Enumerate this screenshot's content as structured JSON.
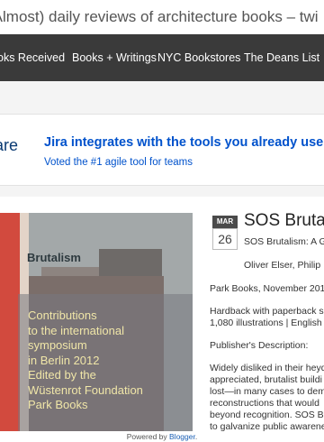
{
  "header": {
    "tagline": "(Almost) daily reviews of architecture books – twi"
  },
  "nav": {
    "items": [
      "oks Received",
      "Books + Writings",
      "NYC Bookstores",
      "The Deans List"
    ]
  },
  "ad": {
    "left_word": "are",
    "headline": "Jira integrates with the tools you already use",
    "subline": "Voted the #1 agile tool for teams"
  },
  "post": {
    "date_month": "MAR",
    "date_day": "26",
    "title": "SOS Bruta",
    "subtitle": "SOS Brutalism: A G",
    "authors": "Oliver Elser, Philip",
    "publisher_line": "Park Books, November 201",
    "format_line1": "Hardback with paperback s",
    "format_line2": "1,080 illustrations | English",
    "description_label": "Publisher's Description:",
    "desc_lines": [
      "Widely disliked in their heyd",
      "appreciated, brutalist buildi",
      "lost—in many cases to dem",
      "reconstructions that would",
      "beyond recognition. SOS B",
      "to galvanize public awarene"
    ]
  },
  "book_cover": {
    "series_label": "Brutalism",
    "cover_text": "Contributions\nto the international\nsymposium\nin Berlin 2012\nEdited by the\nWüstenrot Foundation\nPark Books"
  },
  "footer": {
    "powered_by": "Powered by",
    "platform": "Blogger"
  },
  "colors": {
    "nav_bg": "#3a3a3a",
    "ad_blue": "#0052cc",
    "date_month_bg": "#4a4a4a"
  }
}
